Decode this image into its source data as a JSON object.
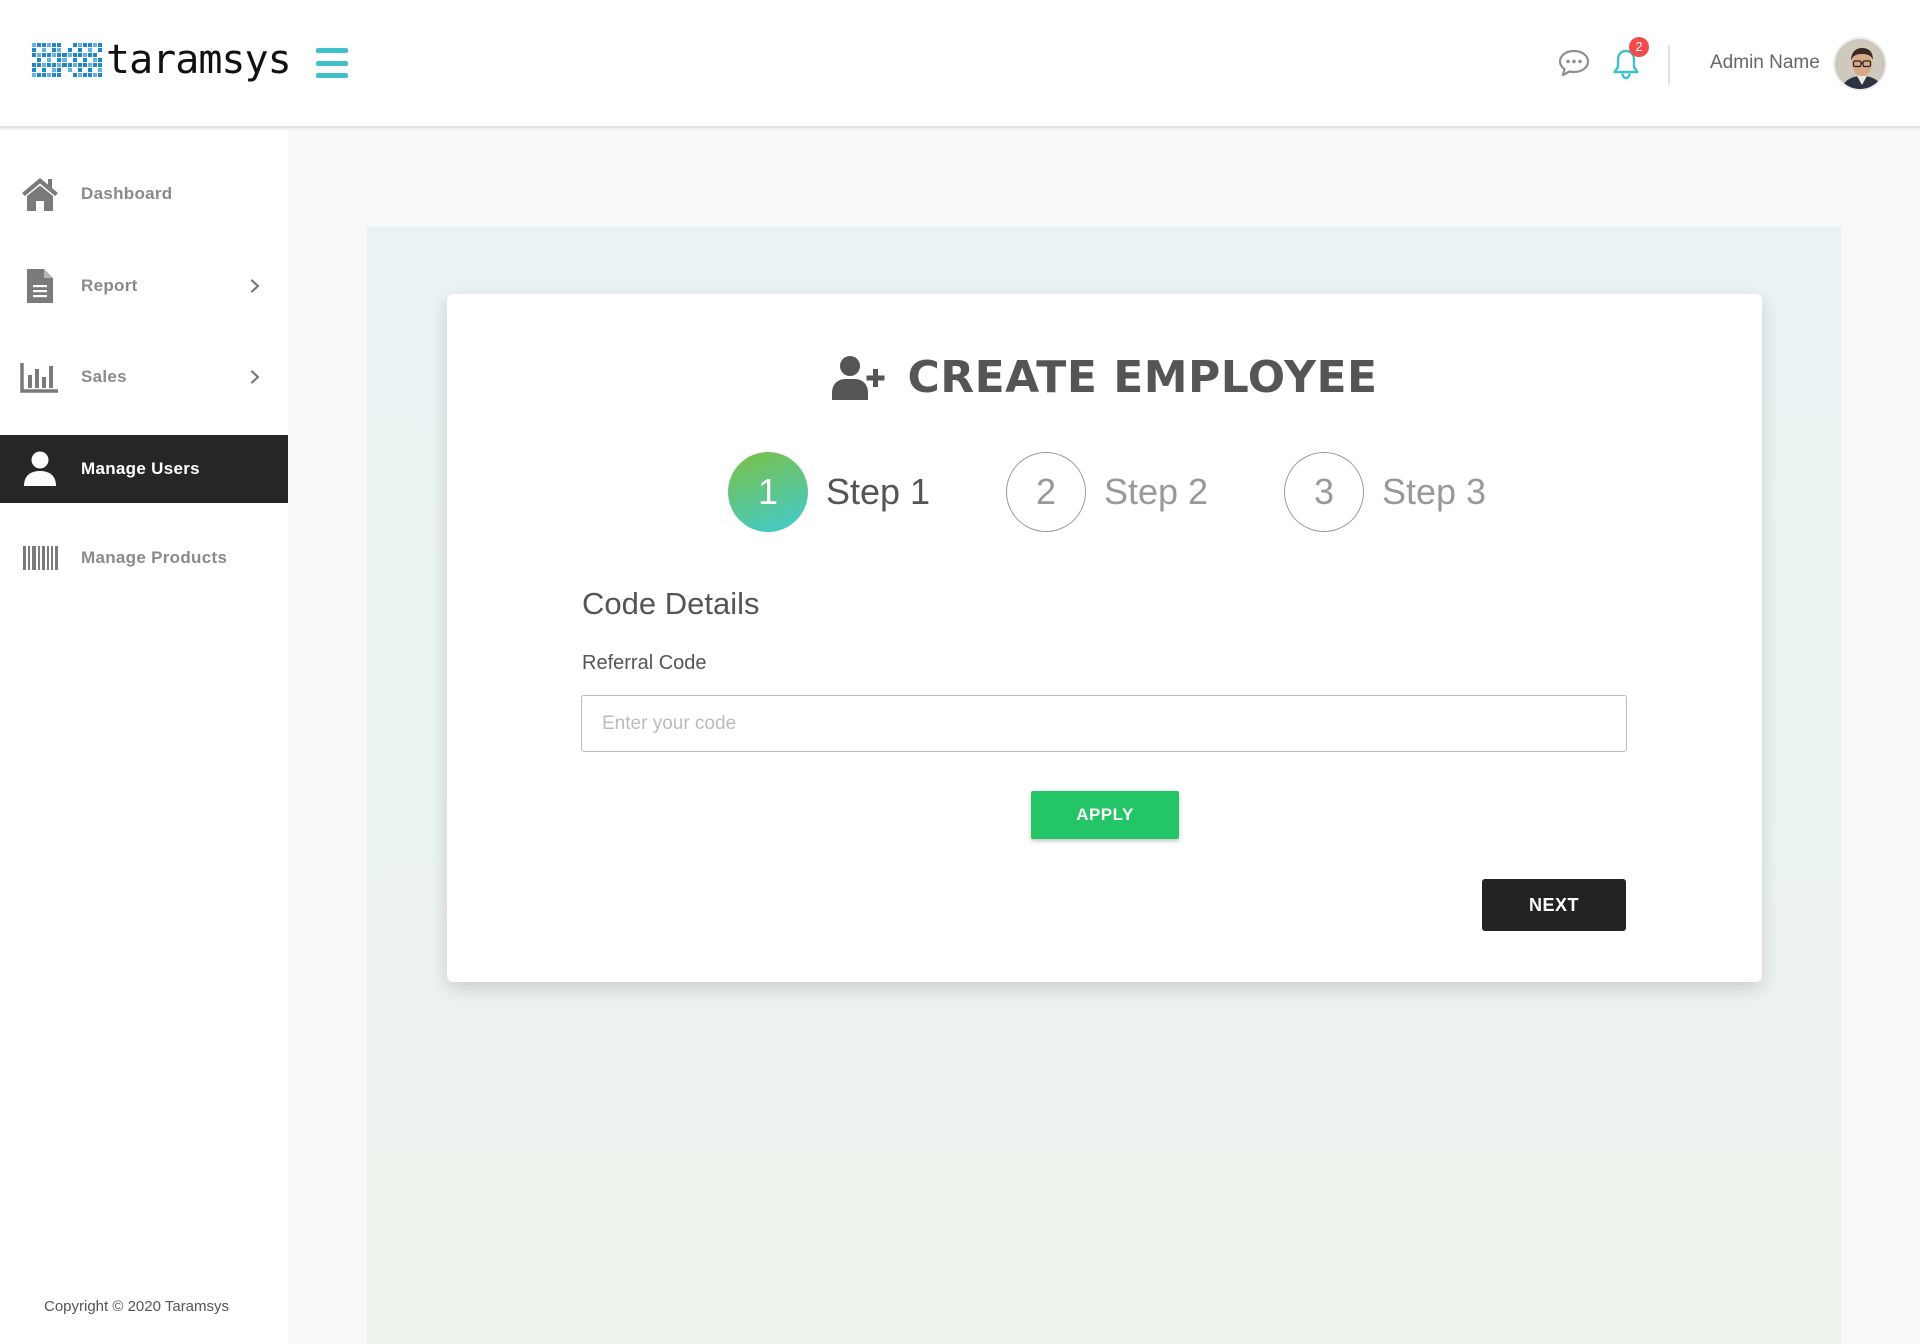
{
  "header": {
    "logo_text": "taramsys",
    "menu_icon": "hamburger-icon",
    "chat_icon": "chat-icon",
    "notification_icon": "bell-icon",
    "notification_count": "2",
    "admin_name": "Admin Name",
    "accent_color": "#3fc1c9",
    "badge_color": "#f14b4b"
  },
  "sidebar": {
    "items": [
      {
        "label": "Dashboard",
        "icon": "home-icon",
        "has_submenu": false,
        "active": false
      },
      {
        "label": "Report",
        "icon": "document-icon",
        "has_submenu": true,
        "active": false
      },
      {
        "label": "Sales",
        "icon": "bar-chart-icon",
        "has_submenu": true,
        "active": false
      },
      {
        "label": "Manage Users",
        "icon": "user-icon",
        "has_submenu": false,
        "active": true
      },
      {
        "label": "Manage Products",
        "icon": "barcode-icon",
        "has_submenu": false,
        "active": false
      }
    ],
    "active_color": "#262626",
    "copyright": "Copyright © 2020 Taramsys"
  },
  "form": {
    "title": "CREATE EMPLOYEE",
    "title_icon": "user-plus-icon",
    "steps": [
      {
        "number": "1",
        "label": "Step 1",
        "active": true
      },
      {
        "number": "2",
        "label": "Step 2",
        "active": false
      },
      {
        "number": "3",
        "label": "Step 3",
        "active": false
      }
    ],
    "section_title": "Code Details",
    "referral_label": "Referral Code",
    "referral_value": "",
    "referral_placeholder": "Enter your code",
    "apply_label": "APPLY",
    "next_label": "NEXT",
    "apply_color": "#24c566",
    "next_color": "#222222"
  }
}
